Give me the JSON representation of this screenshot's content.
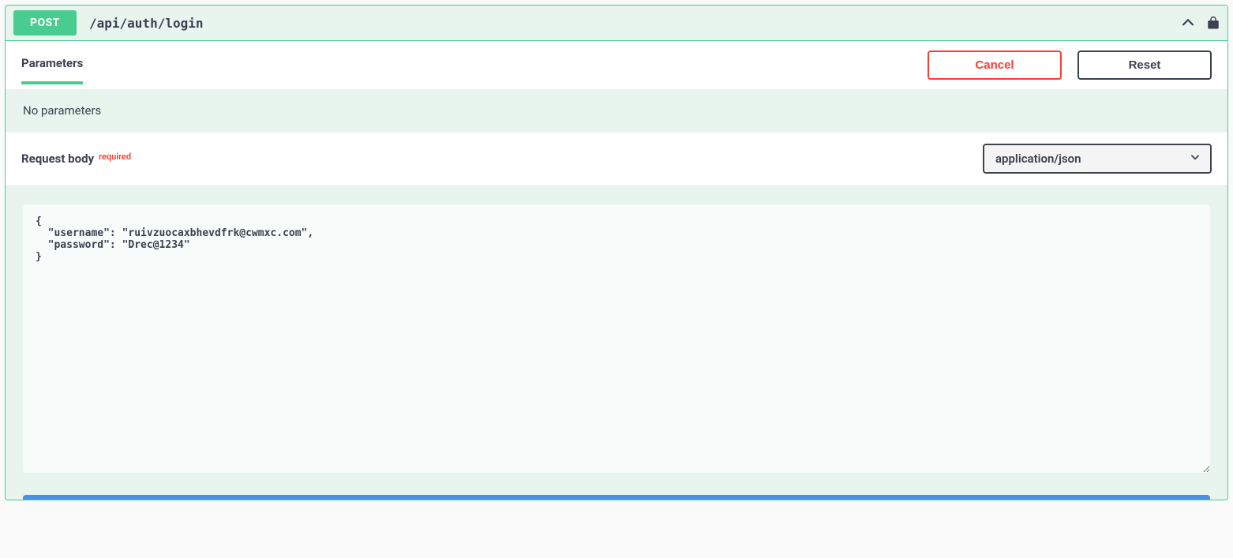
{
  "method": "POST",
  "path": "/api/auth/login",
  "parameters": {
    "heading": "Parameters",
    "cancel_label": "Cancel",
    "reset_label": "Reset",
    "none_text": "No parameters"
  },
  "request_body": {
    "heading": "Request body",
    "required_label": "required",
    "content_type_selected": "application/json",
    "content": "{\n  \"username\": \"ruivzuocaxbhevdfrk@cwmxc.com\",\n  \"password\": \"Drec@1234\"\n}"
  },
  "colors": {
    "accent": "#49cc90",
    "danger": "#ff3b30",
    "primary": "#4990e2",
    "text": "#3b4151"
  }
}
